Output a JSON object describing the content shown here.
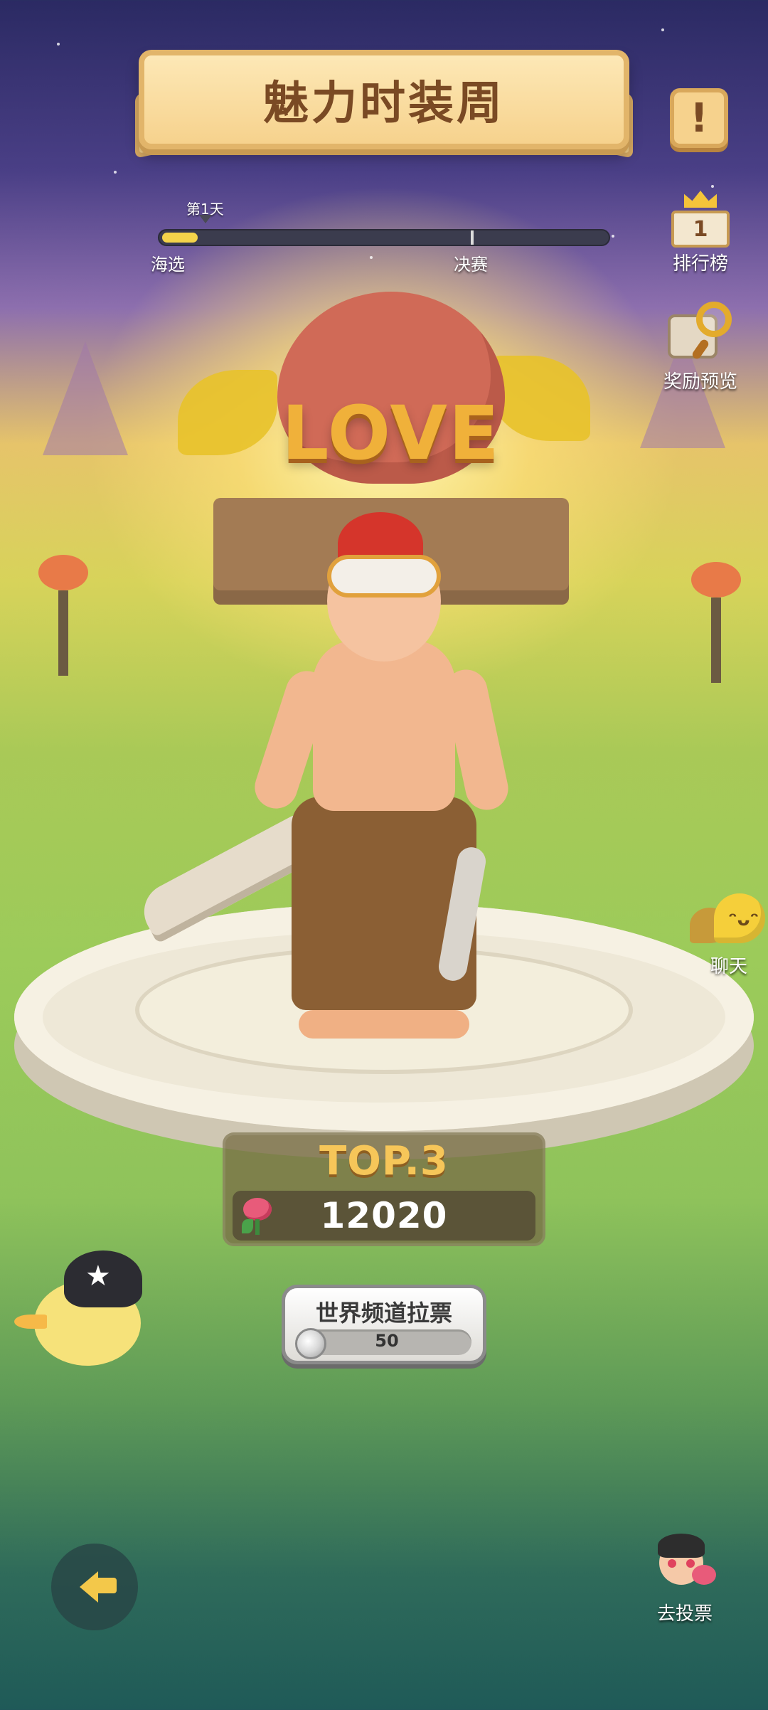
{
  "header": {
    "title": "魅力时装周",
    "info_icon": "exclamation-icon"
  },
  "progress": {
    "day_marker": "第1天",
    "stages": [
      "海选",
      "决赛"
    ],
    "fill_fraction": 0.08
  },
  "side_menu": {
    "leaderboard": {
      "label": "排行榜",
      "icon": "ranking-podium-icon",
      "rank_digit": "1"
    },
    "rewards": {
      "label": "奖励预览",
      "icon": "magnifier-chest-icon"
    },
    "chat": {
      "label": "聊天",
      "icon": "chat-bubble-icon"
    }
  },
  "scene": {
    "monument_text": "LOVE"
  },
  "ranking": {
    "top_label": "TOP.3",
    "score": "12020",
    "score_icon": "rose-icon"
  },
  "canvass": {
    "label": "世界频道拉票",
    "cost": "50",
    "cost_icon": "silver-coin-icon"
  },
  "vote": {
    "label": "去投票",
    "icon": "avatar-with-rose-icon"
  },
  "back": {
    "icon": "back-arrow-icon"
  },
  "colors": {
    "accent_gold": "#f6c659",
    "banner": "#f6d28d",
    "progress_fill": "#f4d34a",
    "text_brown": "#7a4a24"
  }
}
